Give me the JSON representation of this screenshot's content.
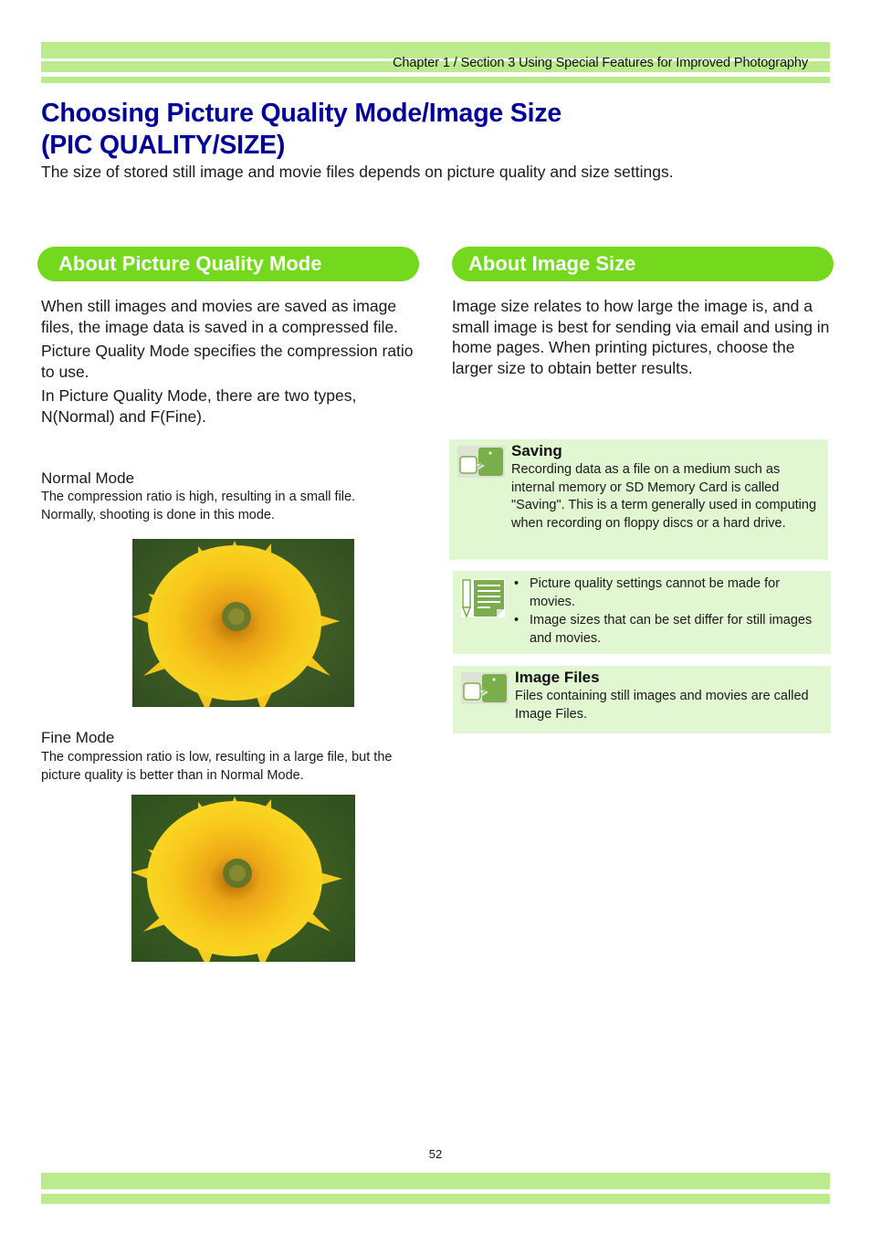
{
  "header": {
    "breadcrumb": "Chapter 1 / Section 3  Using Special Features for Improved Photography"
  },
  "title": {
    "line1": "Choosing Picture Quality Mode/Image Size",
    "line2": "(PIC QUALITY/SIZE)",
    "subtitle": "The size of stored still image and movie files depends on picture quality and size settings."
  },
  "left": {
    "heading": "About Picture Quality Mode",
    "paragraphs": [
      "When still images and movies are saved as image files, the image data is saved in a compressed file.",
      "Picture Quality Mode specifies the compression ratio to use.",
      "In Picture Quality Mode, there are two types, N(Normal) and F(Fine)."
    ],
    "normal_mode": {
      "title": "Normal Mode",
      "description": "The compression ratio is high, resulting in a small file. Normally, shooting is done in this mode.",
      "image": "sunflower-photo-normal"
    },
    "fine_mode": {
      "title": "Fine Mode",
      "description": "The compression ratio is low, resulting in a large file, but the picture quality is better than in Normal Mode.",
      "image": "sunflower-photo-fine"
    }
  },
  "right": {
    "heading": "About Image Size",
    "paragraph": "Image size relates to how large the image is, and a small image is best for sending via email and using in home pages. When printing pictures, choose the larger size to obtain better results.",
    "notes": [
      {
        "icon": "glossary-speech-bubble-icon",
        "title": "Saving",
        "text": "Recording data as a file on a medium such as internal memory or SD Memory Card is called \"Saving\". This is a term generally used in computing when recording on floppy discs or a hard drive."
      },
      {
        "icon": "memo-pencil-icon",
        "items": [
          "Picture quality settings cannot be made for movies.",
          "Image sizes that can be set differ for still images and movies."
        ]
      },
      {
        "icon": "glossary-speech-bubble-icon",
        "title": "Image Files",
        "text": "Files containing still images and movies are called Image Files."
      }
    ]
  },
  "footer": {
    "page_number": "52"
  },
  "colors": {
    "band": "#bbeb8c",
    "title": "#000099",
    "pill": "#74d91c",
    "note_bg": "#e1f7d1",
    "icon_green": "#7aad4c"
  }
}
